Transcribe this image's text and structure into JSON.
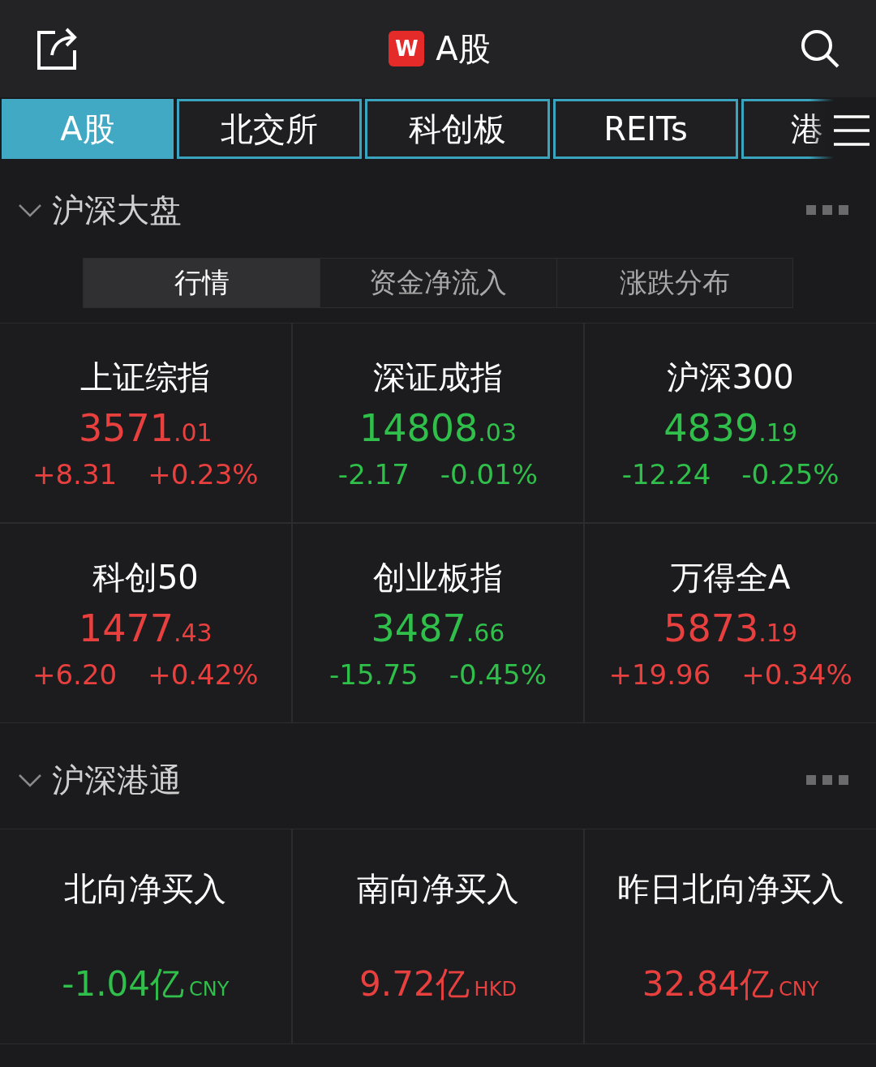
{
  "header": {
    "logo": "W",
    "title": "A股"
  },
  "tabs": [
    {
      "label": "A股",
      "selected": true
    },
    {
      "label": "北交所",
      "selected": false
    },
    {
      "label": "科创板",
      "selected": false
    },
    {
      "label": "REITs",
      "selected": false
    },
    {
      "label": "港",
      "selected": false
    }
  ],
  "sections": [
    {
      "title": "沪深大盘",
      "expanded": true,
      "kind": "indices",
      "segments": [
        {
          "label": "行情",
          "selected": true
        },
        {
          "label": "资金净流入",
          "selected": false
        },
        {
          "label": "涨跌分布",
          "selected": false
        }
      ],
      "items": [
        {
          "name": "上证综指",
          "value": "3571",
          "decimals": ".01",
          "change": "+8.31",
          "percent": "+0.23%",
          "color": "#e8403f"
        },
        {
          "name": "深证成指",
          "value": "14808",
          "decimals": ".03",
          "change": "-2.17",
          "percent": "-0.01%",
          "color": "#2fbf4a"
        },
        {
          "name": "沪深300",
          "value": "4839",
          "decimals": ".19",
          "change": "-12.24",
          "percent": "-0.25%",
          "color": "#2fbf4a"
        },
        {
          "name": "科创50",
          "value": "1477",
          "decimals": ".43",
          "change": "+6.20",
          "percent": "+0.42%",
          "color": "#e8403f"
        },
        {
          "name": "创业板指",
          "value": "3487",
          "decimals": ".66",
          "change": "-15.75",
          "percent": "-0.45%",
          "color": "#2fbf4a"
        },
        {
          "name": "万得全A",
          "value": "5873",
          "decimals": ".19",
          "change": "+19.96",
          "percent": "+0.34%",
          "color": "#e8403f"
        }
      ]
    },
    {
      "title": "沪深港通",
      "expanded": true,
      "kind": "flows",
      "items": [
        {
          "name": "北向净买入",
          "amount": "-1.04亿",
          "currency": "CNY",
          "color": "#2fbf4a"
        },
        {
          "name": "南向净买入",
          "amount": "9.72亿",
          "currency": "HKD",
          "color": "#e8403f"
        },
        {
          "name": "昨日北向净买入",
          "amount": "32.84亿",
          "currency": "CNY",
          "color": "#e8403f"
        }
      ]
    }
  ]
}
